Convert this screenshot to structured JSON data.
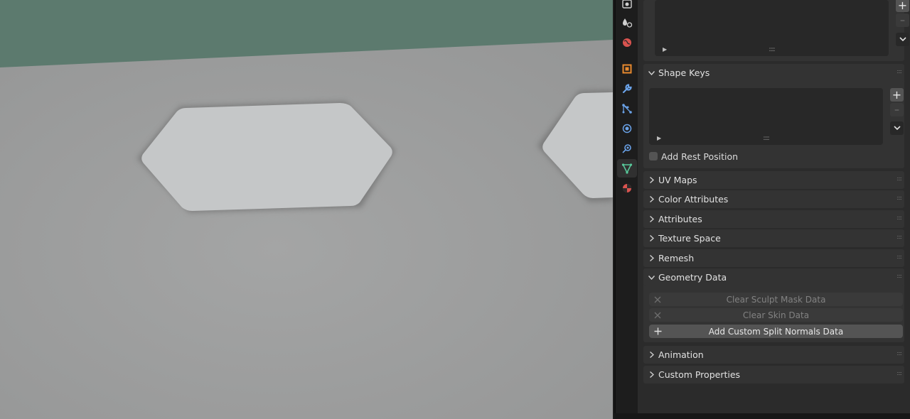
{
  "viewport": {
    "background_color": "#5c7a6e",
    "surface_color": "#9c9d9d",
    "cutout_color": "#c5c7c8"
  },
  "tabs": [
    {
      "name": "render-tab",
      "icon": "camera-icon"
    },
    {
      "name": "physics-tab",
      "icon": "drops-icon"
    },
    {
      "name": "world-tab",
      "icon": "world-icon"
    },
    {
      "name": "object-tab",
      "icon": "object-icon"
    },
    {
      "name": "modifiers-tab",
      "icon": "wrench-icon"
    },
    {
      "name": "particles-tab",
      "icon": "particles-icon"
    },
    {
      "name": "physics2-tab",
      "icon": "physics-icon"
    },
    {
      "name": "constraints-tab",
      "icon": "constraint-icon"
    },
    {
      "name": "data-tab",
      "icon": "mesh-data-icon",
      "active": true
    },
    {
      "name": "material-tab",
      "icon": "material-icon"
    }
  ],
  "shape_keys": {
    "title": "Shape Keys",
    "add_rest_position_label": "Add Rest Position",
    "add_rest_position_checked": false
  },
  "collapsed_panels": [
    {
      "label": "UV Maps"
    },
    {
      "label": "Color Attributes"
    },
    {
      "label": "Attributes"
    },
    {
      "label": "Texture Space"
    },
    {
      "label": "Remesh"
    }
  ],
  "geometry_data": {
    "title": "Geometry Data",
    "buttons": [
      {
        "label": "Clear Sculpt Mask Data",
        "enabled": false
      },
      {
        "label": "Clear Skin Data",
        "enabled": false
      },
      {
        "label": "Add Custom Split Normals Data",
        "enabled": true
      }
    ]
  },
  "bottom_panels": [
    {
      "label": "Animation"
    },
    {
      "label": "Custom Properties"
    }
  ],
  "icon_colors": {
    "object": "#e8892e",
    "blue": "#6aa2e8",
    "world": "#d9534f",
    "data": "#58c89a",
    "material": "#d9534f"
  }
}
